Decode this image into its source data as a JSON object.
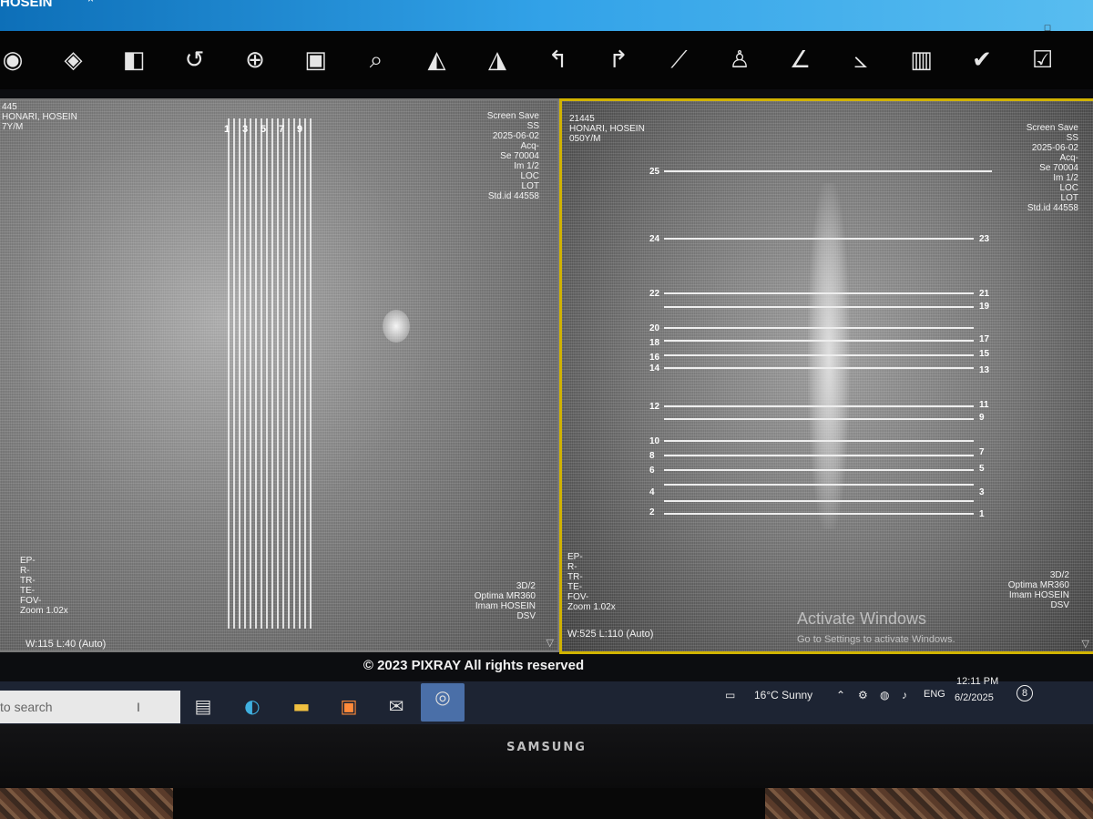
{
  "window": {
    "title": "HOSEIN",
    "close_glyph": "×"
  },
  "toolbar": {
    "tools": [
      {
        "name": "window-level-icon",
        "glyph": "◉"
      },
      {
        "name": "layers-icon",
        "glyph": "◈"
      },
      {
        "name": "invert-icon",
        "glyph": "◧"
      },
      {
        "name": "rotate-icon",
        "glyph": "↺"
      },
      {
        "name": "zoom-icon",
        "glyph": "⊕"
      },
      {
        "name": "fit-icon",
        "glyph": "▣"
      },
      {
        "name": "magnify-icon",
        "glyph": "⌕"
      },
      {
        "name": "flip-horizontal-icon",
        "glyph": "◭"
      },
      {
        "name": "flip-vertical-icon",
        "glyph": "◮"
      },
      {
        "name": "rotate-left-icon",
        "glyph": "↰"
      },
      {
        "name": "rotate-right-icon",
        "glyph": "↱"
      },
      {
        "name": "ruler-icon",
        "glyph": "⟋"
      },
      {
        "name": "person-icon",
        "glyph": "♙"
      },
      {
        "name": "angle-icon",
        "glyph": "∠"
      },
      {
        "name": "cobb-angle-icon",
        "glyph": "⦣"
      },
      {
        "name": "spine-label-icon",
        "glyph": "▥"
      },
      {
        "name": "check-circle-icon",
        "glyph": "✔"
      },
      {
        "name": "checkbox-icon",
        "glyph": "☑"
      }
    ]
  },
  "left_view": {
    "top_left": [
      "445",
      "HONARI, HOSEIN",
      "7Y/M"
    ],
    "top_right": [
      "Screen Save",
      "SS",
      "2025-06-02",
      "Acq-",
      "Se 70004",
      "Im 1/2",
      "LOC",
      "LOT",
      "Std.id 44558"
    ],
    "bottom_left": [
      "EP-",
      "R-",
      "TR-",
      "TE-",
      "FOV-",
      "Zoom 1.02x"
    ],
    "bottom_right": [
      "3D/2",
      "Optima MR360",
      "Imam HOSEIN",
      "DSV"
    ],
    "window_level": "W:115 L:40 (Auto)",
    "stripe_labels": [
      "1",
      "3",
      "5",
      "7",
      "9"
    ]
  },
  "right_view": {
    "top_left": [
      "21445",
      "HONARI, HOSEIN",
      "050Y/M"
    ],
    "top_right": [
      "Screen Save",
      "SS",
      "2025-06-02",
      "Acq-",
      "Se 70004",
      "Im 1/2",
      "LOC",
      "LOT",
      "Std.id 44558"
    ],
    "bottom_left": [
      "EP-",
      "R-",
      "TR-",
      "TE-",
      "FOV-",
      "Zoom 1.02x"
    ],
    "bottom_right": [
      "3D/2",
      "Optima MR360",
      "Imam HOSEIN",
      "DSV"
    ],
    "window_level": "W:525 L:110 (Auto)",
    "line_labels_left": [
      "25",
      "24",
      "22",
      "20",
      "18",
      "16",
      "14",
      "12",
      "10",
      "8",
      "6",
      "4",
      "2"
    ],
    "line_labels_right": [
      "23",
      "21",
      "19",
      "17",
      "15",
      "13",
      "11",
      "9",
      "7",
      "5",
      "3",
      "1"
    ],
    "watermark_title": "Activate Windows",
    "watermark_sub": "Go to Settings to activate Windows."
  },
  "footer": {
    "copyright": "© 2023 PIXRAY All rights reserved"
  },
  "taskbar": {
    "search_placeholder": "to search",
    "weather": "16°C Sunny",
    "language": "ENG",
    "time": "12:11 PM",
    "date": "6/2/2025",
    "notifications": "8"
  },
  "monitor": {
    "brand": "SAMSUNG"
  }
}
